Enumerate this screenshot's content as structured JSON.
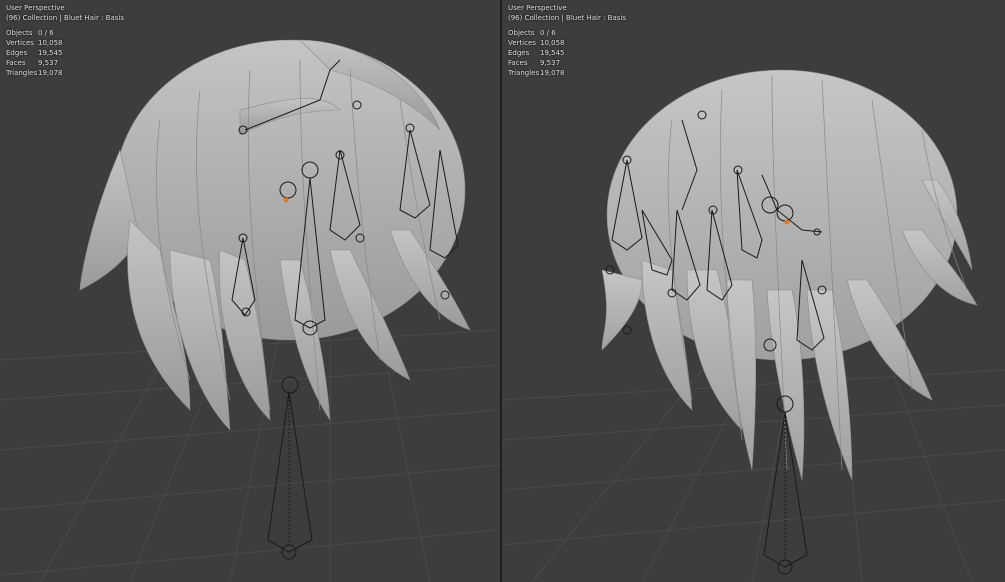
{
  "viewports": [
    {
      "view_name": "User Perspective",
      "collection_info": "(96) Collection | Bluet Hair : Basis",
      "stats": [
        {
          "label": "Objects",
          "value": "0 / 6"
        },
        {
          "label": "Vertices",
          "value": "10,058"
        },
        {
          "label": "Edges",
          "value": "19,545"
        },
        {
          "label": "Faces",
          "value": "9,537"
        },
        {
          "label": "Triangles",
          "value": "19,078"
        }
      ]
    },
    {
      "view_name": "User Perspective",
      "collection_info": "(96) Collection | Bluet Hair : Basis",
      "stats": [
        {
          "label": "Objects",
          "value": "0 / 6"
        },
        {
          "label": "Vertices",
          "value": "10,058"
        },
        {
          "label": "Edges",
          "value": "19,545"
        },
        {
          "label": "Faces",
          "value": "9,537"
        },
        {
          "label": "Triangles",
          "value": "19,078"
        }
      ]
    }
  ],
  "colors": {
    "background": "#3d3d3d",
    "grid_line": "#4a4a4a",
    "hair": "#b9b9b9",
    "bone_line": "#1a1a1a",
    "selection": "#e07a1f"
  },
  "icons": [
    "hair-mesh-icon",
    "armature-bone-icon"
  ]
}
